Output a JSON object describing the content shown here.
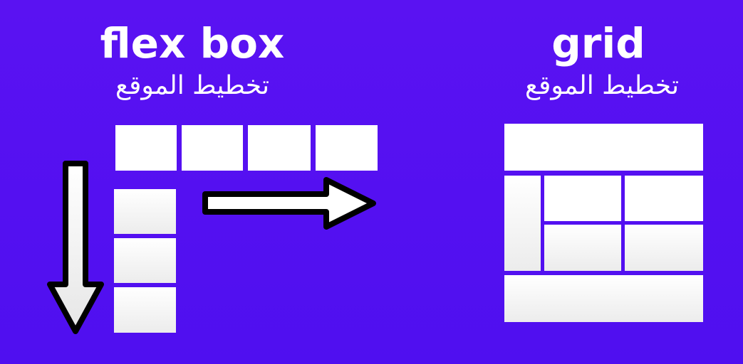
{
  "flexbox": {
    "title": "flex box",
    "subtitle": "تخطيط الموقع"
  },
  "grid": {
    "title": "grid",
    "subtitle": "تخطيط الموقع"
  },
  "colors": {
    "background": "#5a12f2",
    "box": "#ffffff",
    "arrow_outline": "#000000"
  },
  "icons": [
    "arrow-down-icon",
    "arrow-right-icon"
  ]
}
